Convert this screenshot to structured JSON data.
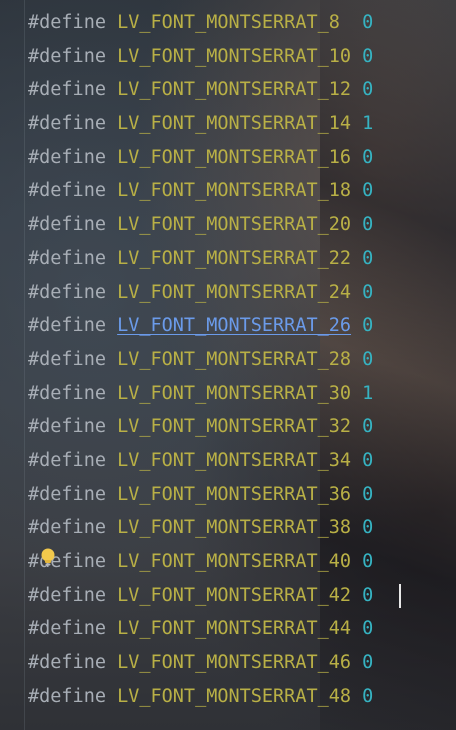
{
  "editor": {
    "language": "C",
    "colors": {
      "keyword": "#a8aeb6",
      "macro": "#b9b046",
      "macro_link": "#6b9bea",
      "value": "#36b3c2"
    },
    "lines": [
      {
        "directive": "#define",
        "macro": "LV_FONT_MONTSERRAT_8",
        "pad": "  ",
        "value": "0"
      },
      {
        "directive": "#define",
        "macro": "LV_FONT_MONTSERRAT_10",
        "pad": " ",
        "value": "0"
      },
      {
        "directive": "#define",
        "macro": "LV_FONT_MONTSERRAT_12",
        "pad": " ",
        "value": "0"
      },
      {
        "directive": "#define",
        "macro": "LV_FONT_MONTSERRAT_14",
        "pad": " ",
        "value": "1"
      },
      {
        "directive": "#define",
        "macro": "LV_FONT_MONTSERRAT_16",
        "pad": " ",
        "value": "0"
      },
      {
        "directive": "#define",
        "macro": "LV_FONT_MONTSERRAT_18",
        "pad": " ",
        "value": "0"
      },
      {
        "directive": "#define",
        "macro": "LV_FONT_MONTSERRAT_20",
        "pad": " ",
        "value": "0"
      },
      {
        "directive": "#define",
        "macro": "LV_FONT_MONTSERRAT_22",
        "pad": " ",
        "value": "0"
      },
      {
        "directive": "#define",
        "macro": "LV_FONT_MONTSERRAT_24",
        "pad": " ",
        "value": "0"
      },
      {
        "directive": "#define",
        "macro": "LV_FONT_MONTSERRAT_26",
        "pad": " ",
        "value": "0",
        "hovered_link": true
      },
      {
        "directive": "#define",
        "macro": "LV_FONT_MONTSERRAT_28",
        "pad": " ",
        "value": "0"
      },
      {
        "directive": "#define",
        "macro": "LV_FONT_MONTSERRAT_30",
        "pad": " ",
        "value": "1"
      },
      {
        "directive": "#define",
        "macro": "LV_FONT_MONTSERRAT_32",
        "pad": " ",
        "value": "0"
      },
      {
        "directive": "#define",
        "macro": "LV_FONT_MONTSERRAT_34",
        "pad": " ",
        "value": "0"
      },
      {
        "directive": "#define",
        "macro": "LV_FONT_MONTSERRAT_36",
        "pad": " ",
        "value": "0"
      },
      {
        "directive": "#define",
        "macro": "LV_FONT_MONTSERRAT_38",
        "pad": " ",
        "value": "0"
      },
      {
        "directive": "#define",
        "macro": "LV_FONT_MONTSERRAT_40",
        "pad": " ",
        "value": "0"
      },
      {
        "directive": "#define",
        "macro": "LV_FONT_MONTSERRAT_42",
        "pad": " ",
        "value": "0",
        "caret": true
      },
      {
        "directive": "#define",
        "macro": "LV_FONT_MONTSERRAT_44",
        "pad": " ",
        "value": "0"
      },
      {
        "directive": "#define",
        "macro": "LV_FONT_MONTSERRAT_46",
        "pad": " ",
        "value": "0"
      },
      {
        "directive": "#define",
        "macro": "LV_FONT_MONTSERRAT_48",
        "pad": " ",
        "value": "0"
      }
    ],
    "intention_icon": "lightbulb-icon"
  }
}
